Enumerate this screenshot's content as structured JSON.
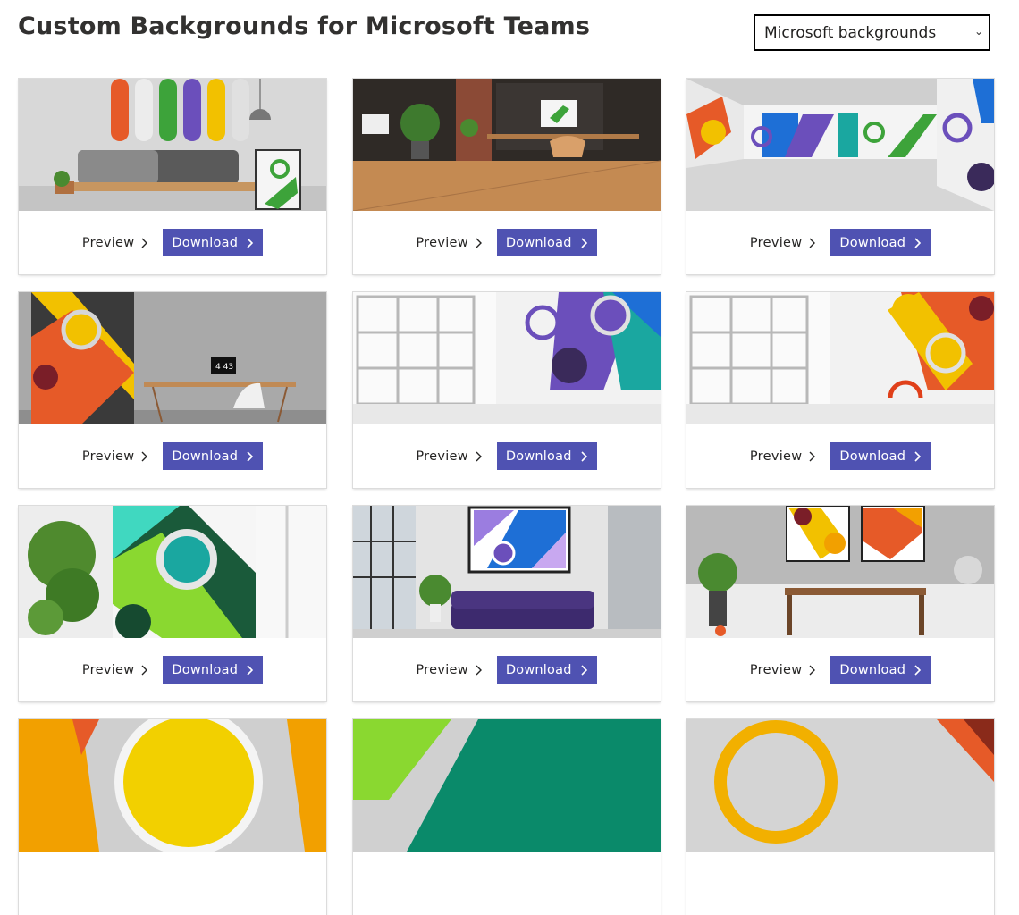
{
  "header": {
    "title": "Custom Backgrounds for Microsoft Teams",
    "filter_selected": "Microsoft backgrounds"
  },
  "card_actions": {
    "preview_label": "Preview",
    "download_label": "Download"
  },
  "colors": {
    "accent": "#4f52b2",
    "purple": "#6b4fbb",
    "blue": "#1e6fd6",
    "green": "#3da33a",
    "orange": "#e65a28",
    "yellow": "#f2c100",
    "teal": "#1aa7a0"
  },
  "cards": [
    {
      "scene": "living-room-wall-skis"
    },
    {
      "scene": "wood-office"
    },
    {
      "scene": "mural-room"
    },
    {
      "scene": "concrete-desk"
    },
    {
      "scene": "white-room-purple"
    },
    {
      "scene": "white-room-orange"
    },
    {
      "scene": "plant-green-panel"
    },
    {
      "scene": "purple-sofa-loft"
    },
    {
      "scene": "concrete-shelf-desk"
    },
    {
      "scene": "yellow-circle"
    },
    {
      "scene": "green-teal"
    },
    {
      "scene": "orange-ring"
    }
  ],
  "clock_readout": "4 43"
}
